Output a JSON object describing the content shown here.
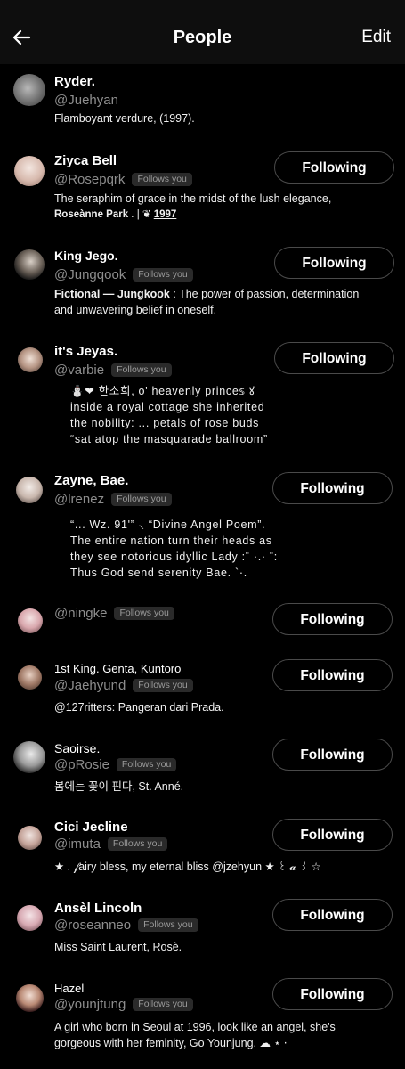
{
  "header": {
    "title": "People",
    "edit_label": "Edit",
    "back_icon": "back-arrow-icon"
  },
  "users": [
    {
      "name": "Ryder.",
      "handle": "@Juehyan",
      "follows_you": "",
      "button": "",
      "bio": [
        "Flamboyant verdure, (1997)."
      ]
    },
    {
      "name": "Ziyca Bell",
      "handle": "@Rosepqrk",
      "follows_you": "Follows you",
      "button": "Following",
      "bio": [
        "The seraphim of grace in the midst of the lush elegance,"
      ],
      "bio_rich": {
        "strong": "Roseànne Park",
        "sep": " . | ❦ ",
        "link": "1997"
      }
    },
    {
      "name": "King Jego.",
      "handle": "@Jungqook",
      "follows_you": "Follows you",
      "button": "Following",
      "bio_rich2": {
        "strong": "Fictional — Jungkook",
        "rest": " : The power of passion, determination"
      },
      "bio": [
        "and unwavering belief in oneself."
      ]
    },
    {
      "name": "it's Jeyas.",
      "handle": "@varbie",
      "follows_you": "Follows you",
      "button": "Following",
      "bio": [
        "⛄❤  한소희,  o'  heavenly  prince𝕤  ꙋ",
        "inside  a  royal  cottage  she  inherited",
        "the  nobility:  ...  petals  of  rose  buds",
        "“sat  atop  the  masquarade  ballroom”"
      ]
    },
    {
      "name": "Zayne, Bae.",
      "handle": "@lrenez",
      "follows_you": "Follows you",
      "button": "Following",
      "bio": [
        "“...  Wz.  91'”   ⸜  “Divine  Angel  Poem”.",
        "The  entire  nation  turn  their  heads  as",
        "they  see  notorious  idyllic  Lady  :¨ ·.· ¨:",
        "Thus  God  send  serenity  Bae.    `·."
      ]
    },
    {
      "name": "",
      "handle": "@ningke",
      "follows_you": "Follows you",
      "button": "Following",
      "bio": []
    },
    {
      "name": "1st King. Genta, Kuntoro",
      "handle": "@Jaehyund",
      "follows_you": "Follows you",
      "button": "Following",
      "bio": [
        "@127ritters: Pangeran dari Prada."
      ]
    },
    {
      "name": "Saoirse.",
      "handle": "@pRosie",
      "follows_you": "Follows you",
      "button": "Following",
      "bio": [
        "봄에는 꽃이 핀다, St. Anné."
      ]
    },
    {
      "name": "Cici Jecline",
      "handle": "@imuta",
      "follows_you": "Follows you",
      "button": "Following",
      "bio": [
        "★ . 𝒻airy bless, my eternal bliss @jzehyun ★ ꒰ 𝓪 ꒱ ☆"
      ]
    },
    {
      "name": "Ansèl Lincoln",
      "handle": "@roseanneo",
      "follows_you": "Follows you",
      "button": "Following",
      "bio": [
        "Miss Saint Laurent, Rosè."
      ]
    },
    {
      "name": "Hazel",
      "handle": "@younjtung",
      "follows_you": "Follows you",
      "button": "Following",
      "bio": [
        "A girl who born in Seoul at 1996, look like an angel, she's",
        "gorgeous with her feminity, Go Younjung. ☁︎ ⋆ ⋅"
      ]
    }
  ],
  "colors": {
    "background": "#000000",
    "header": "#0e0e0e",
    "secondary_text": "#8d8d8d",
    "badge_bg": "#2a2a2a",
    "button_border": "#4a4a4a"
  }
}
